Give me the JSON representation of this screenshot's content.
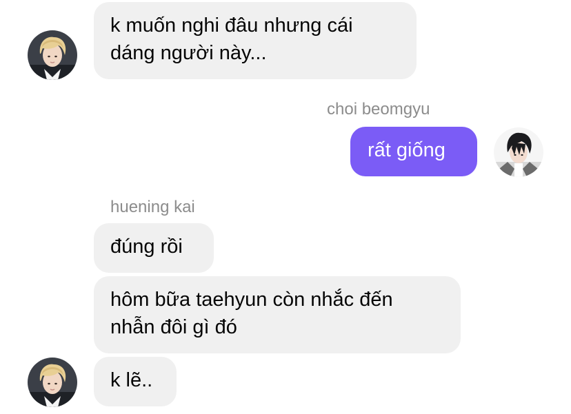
{
  "thread": {
    "messages": [
      {
        "direction": "incoming",
        "sender": "",
        "text": "k muốn nghi đâu nhưng cái\ndáng người này..."
      },
      {
        "direction": "outgoing",
        "sender": "choi beomgyu",
        "text": "rất giống"
      },
      {
        "direction": "incoming",
        "sender": "huening kai",
        "text": "đúng rồi"
      },
      {
        "direction": "incoming",
        "sender": "",
        "text": "hôm bữa taehyun còn nhắc đến\nnhẫn đôi gì đó"
      },
      {
        "direction": "incoming",
        "sender": "",
        "text": "k lẽ.."
      }
    ]
  },
  "avatars": {
    "incoming": "blond-person-avatar",
    "outgoing": "dark-hair-person-avatar"
  },
  "colors": {
    "incoming_bubble": "#f0f0f0",
    "outgoing_bubble": "#7b5cf6",
    "sender_name": "#8c8c8c"
  }
}
